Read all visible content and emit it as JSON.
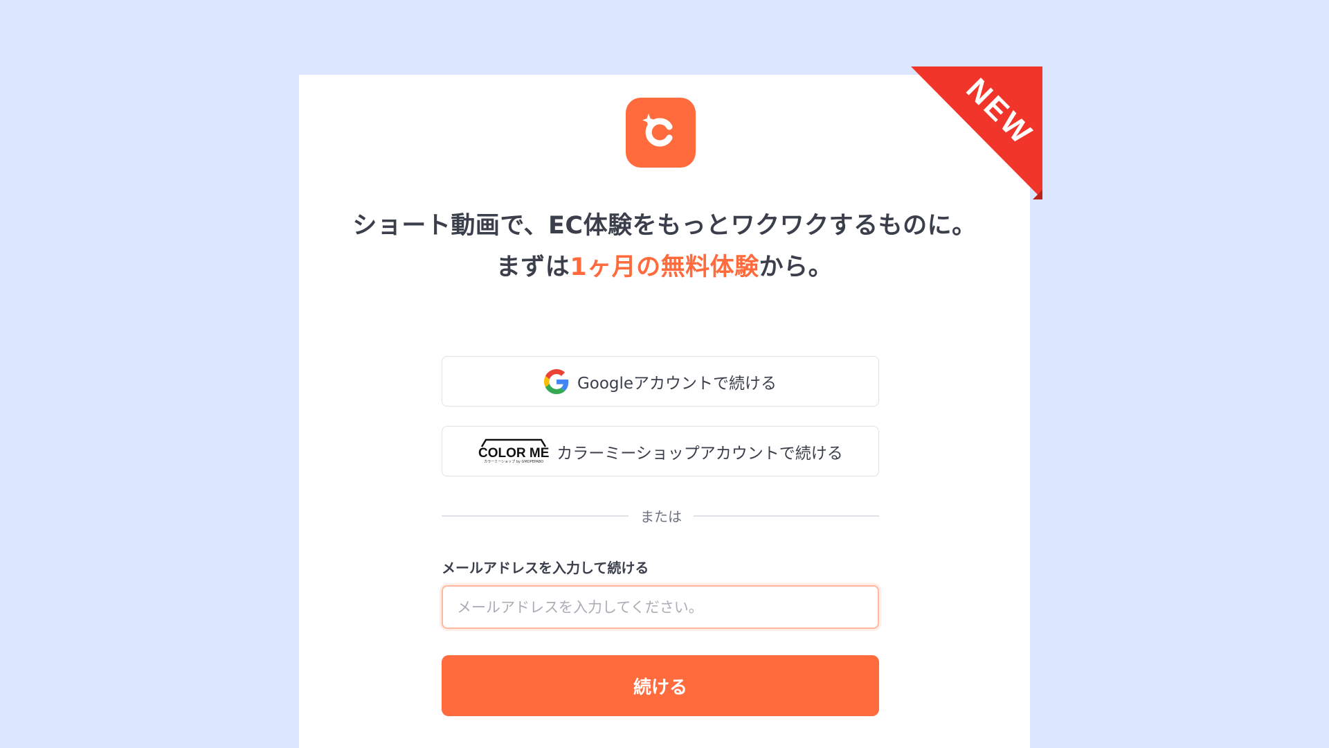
{
  "badge": {
    "text": "NEW"
  },
  "headline": {
    "line1": "ショート動画で、EC体験をもっとワクワクするものに。",
    "line2_prefix": "まずは",
    "line2_accent": "1ヶ月の無料体験",
    "line2_suffix": "から。"
  },
  "social_login": {
    "google_label": "Googleアカウントで続ける",
    "colorme_label": "カラーミーショップアカウントで続ける",
    "colorme_logo_text": "COLOR ME",
    "colorme_logo_subtext": "カラーミーショップ by GMOPEPABO"
  },
  "divider": {
    "text": "または"
  },
  "email": {
    "label": "メールアドレスを入力して続ける",
    "value": "",
    "placeholder": "メールアドレスを入力してください。"
  },
  "submit": {
    "label": "続ける"
  },
  "colors": {
    "accent": "#ff6b3d",
    "background": "#dde6ff",
    "ribbon": "#f2352a"
  }
}
